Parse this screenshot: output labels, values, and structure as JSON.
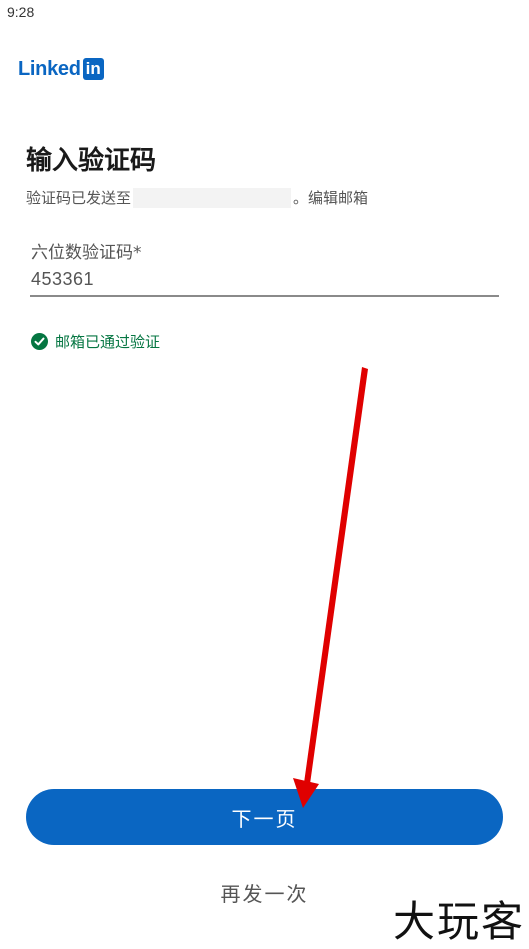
{
  "status_bar": {
    "time": "9:28"
  },
  "logo": {
    "text": "Linked",
    "box": "in"
  },
  "page": {
    "title": "输入验证码",
    "subtitle_prefix": "验证码已发送至",
    "subtitle_suffix": "。",
    "edit_email": "编辑邮箱"
  },
  "code_field": {
    "label": "六位数验证码*",
    "value": "453361"
  },
  "verified": {
    "text": "邮箱已通过验证"
  },
  "buttons": {
    "next": "下一页",
    "resend": "再发一次"
  },
  "watermark": "大玩客",
  "colors": {
    "brand": "#0a66c2",
    "success": "#057642",
    "arrow": "#e00000"
  }
}
